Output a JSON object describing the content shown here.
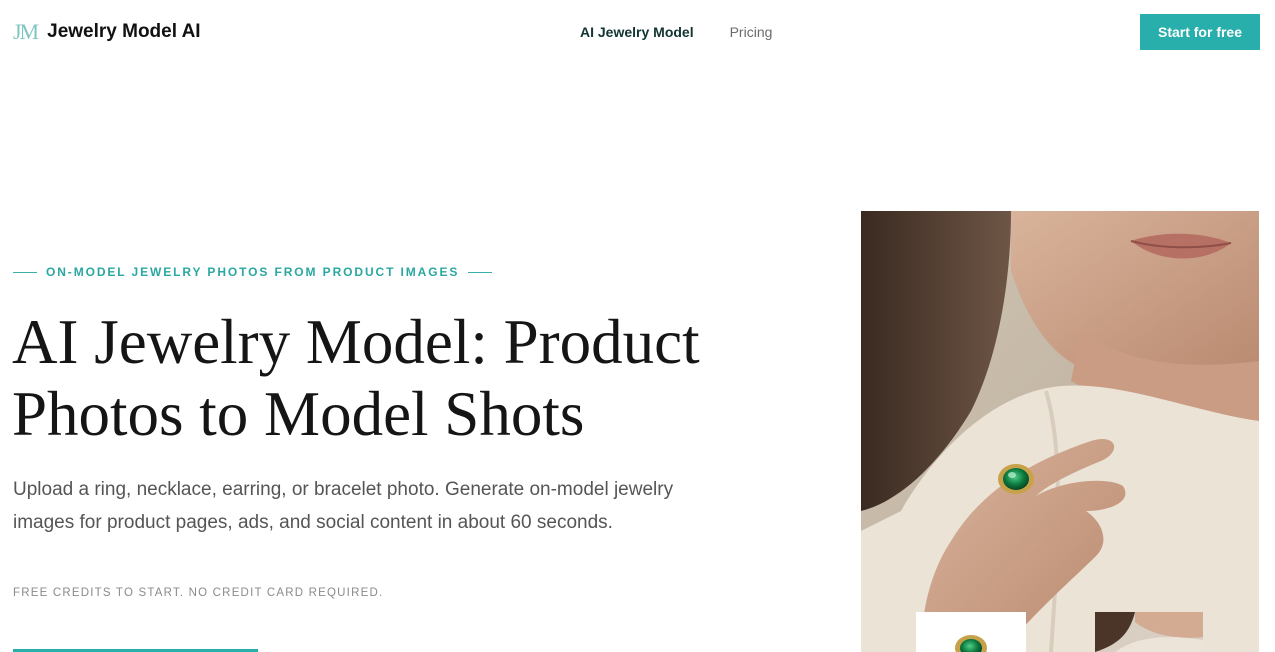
{
  "header": {
    "logo_mark": "JM",
    "logo_text": "Jewelry Model AI",
    "nav": [
      {
        "label": "AI Jewelry Model",
        "active": true
      },
      {
        "label": "Pricing",
        "active": false
      }
    ],
    "cta_label": "Start for free"
  },
  "hero": {
    "eyebrow": "ON-MODEL JEWELRY PHOTOS FROM PRODUCT IMAGES",
    "headline_line1": "AI Jewelry Model: Product",
    "headline_line2": "Photos to Model Shots",
    "subtext": "Upload a ring, necklace, earring, or bracelet photo. Generate on-model jewelry images for product pages, ads, and social content in about 60 seconds.",
    "fineprint": "FREE CREDITS TO START. NO CREDIT CARD REQUIRED."
  },
  "colors": {
    "accent": "#29afab",
    "logo_mark": "#7fc6c1",
    "eyebrow": "#2aa7a2",
    "text_dark": "#151515",
    "text_muted": "#555555"
  },
  "icons": {
    "logo": "jm-monogram-icon"
  }
}
